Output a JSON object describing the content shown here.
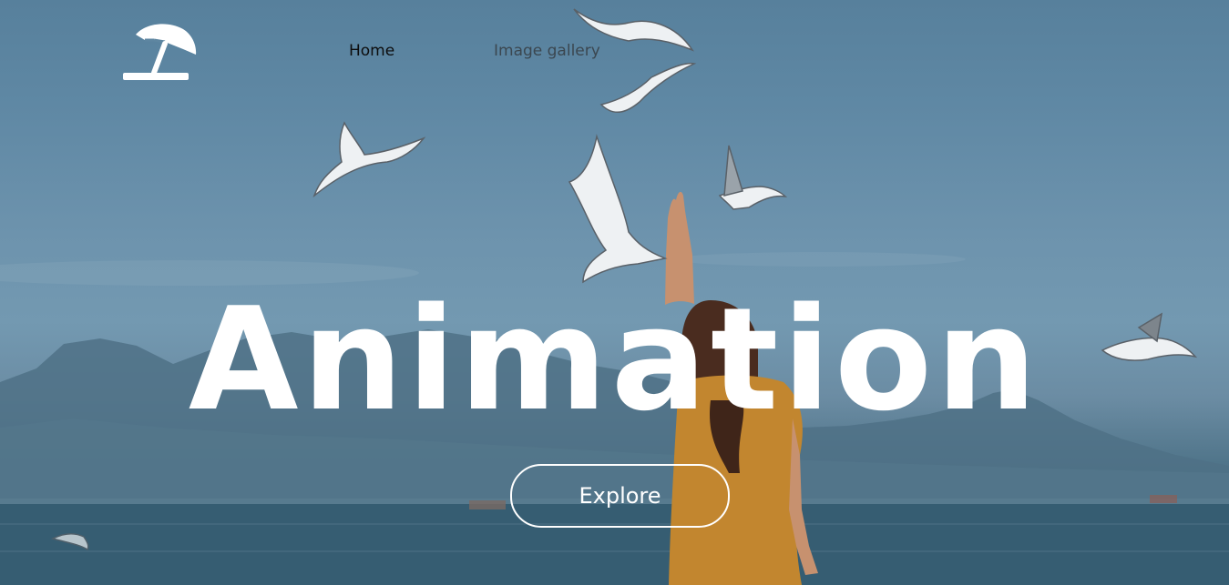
{
  "nav": {
    "items": [
      {
        "label": "Home",
        "active": true
      },
      {
        "label": "Image gallery",
        "active": false
      }
    ]
  },
  "logo": {
    "icon": "beach-umbrella-icon"
  },
  "hero": {
    "title": "Animation",
    "button_label": "Explore",
    "background": "photo: woman in mustard dress raising hand toward flying seagulls by the sea with mountains"
  },
  "colors": {
    "sky": "#6d93ad",
    "sea": "#3f6477",
    "dress": "#c2862f",
    "text": "#ffffff",
    "nav_active": "#0d0d0d",
    "nav_inactive": "#3b4750"
  }
}
